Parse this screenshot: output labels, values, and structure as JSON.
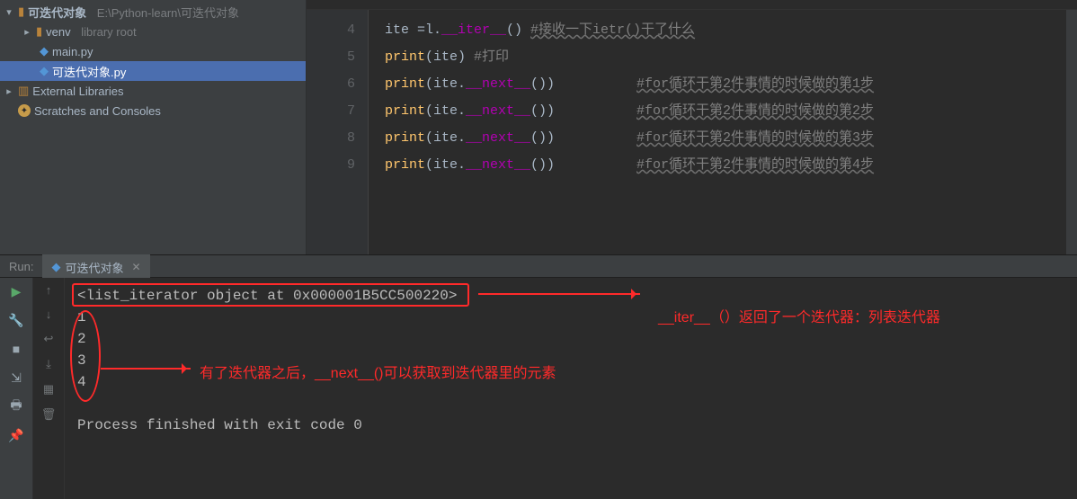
{
  "tree": {
    "root_name": "可迭代对象",
    "root_path": "E:\\Python-learn\\可迭代对象",
    "venv": "venv",
    "venv_hint": "library root",
    "main": "main.py",
    "current": "可迭代对象.py",
    "ext": "External Libraries",
    "scratch": "Scratches and Consoles"
  },
  "gutter": [
    "4",
    "5",
    "6",
    "7",
    "8",
    "9"
  ],
  "code": {
    "l4a": "ite =l.",
    "l4b": "__iter__",
    "l4c": "()  ",
    "l4cmt": "#接收一下ietr()干了什么",
    "l5a": "print",
    "l5b": "(ite)   ",
    "l5cmt": "#打印",
    "l6a": "print",
    "l6b": "(ite.",
    "l6c": "__next__",
    "l6d": "())",
    "l6cmt": "#for循环干第2件事情的时候做的第1步",
    "l7a": "print",
    "l7b": "(ite.",
    "l7c": "__next__",
    "l7d": "())",
    "l7cmt": "#for循环干第2件事情的时候做的第2步",
    "l8a": "print",
    "l8b": "(ite.",
    "l8c": "__next__",
    "l8d": "())",
    "l8cmt": "#for循环干第2件事情的时候做的第3步",
    "l9a": "print",
    "l9b": "(ite.",
    "l9c": "__next__",
    "l9d": "())",
    "l9cmt": "#for循环干第2件事情的时候做的第4步"
  },
  "run": {
    "label": "Run:",
    "tab": "可迭代对象"
  },
  "console": {
    "out1": "<list_iterator object at 0x000001B5CC500220>",
    "out2": "1",
    "out3": "2",
    "out4": "3",
    "out5": "4",
    "exit": "Process finished with exit code 0"
  },
  "annotations": {
    "iter": "__iter__（）返回了一个迭代器：列表迭代器",
    "next": "有了迭代器之后，__next__()可以获取到迭代器里的元素"
  },
  "colors": {
    "annotation": "#ff2a2a"
  }
}
